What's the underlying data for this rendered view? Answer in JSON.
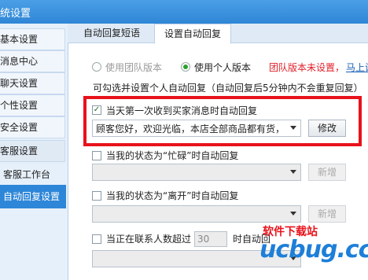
{
  "window": {
    "title": "统设置"
  },
  "sidebar": {
    "items": [
      {
        "label": "基本设置"
      },
      {
        "label": "消息中心"
      },
      {
        "label": "聊天设置"
      },
      {
        "label": "个性设置"
      },
      {
        "label": "安全设置"
      },
      {
        "label": "客服设置"
      },
      {
        "label": "客服工作台"
      },
      {
        "label": "自动回复设置"
      }
    ]
  },
  "tabs": [
    {
      "label": "自动回复短语"
    },
    {
      "label": "设置自动回复"
    }
  ],
  "mode": {
    "team_label": "使用团队版本",
    "personal_label": "使用个人版本",
    "team_notice": "团队版本未设置，",
    "link": "马上设"
  },
  "description": "可勾选并设置个人自动回复（自动回复后5分钟内不会重复回复）",
  "rules": {
    "first_message": {
      "label": "当天第一次收到买家消息时自动回复",
      "checked": true,
      "value": "顾客您好，欢迎光临，本店全部商品都有货，",
      "button": "修改"
    },
    "busy": {
      "label": "当我的状态为“忙碌”时自动回复",
      "button": "新增"
    },
    "away": {
      "label": "当我的状态为“离开”时自动回复",
      "button": "新增"
    },
    "contacts": {
      "label_prefix": "当正在联系人数超过",
      "count": "30",
      "label_suffix": "时自动回"
    }
  },
  "watermark": {
    "text": "软件下载站",
    "logo": "ucbug.cc"
  },
  "colors": {
    "accent": "#2e86d8",
    "highlight_box": "#e8121b",
    "notice_red": "#e0202a",
    "radio_on": "#2aa12a"
  }
}
